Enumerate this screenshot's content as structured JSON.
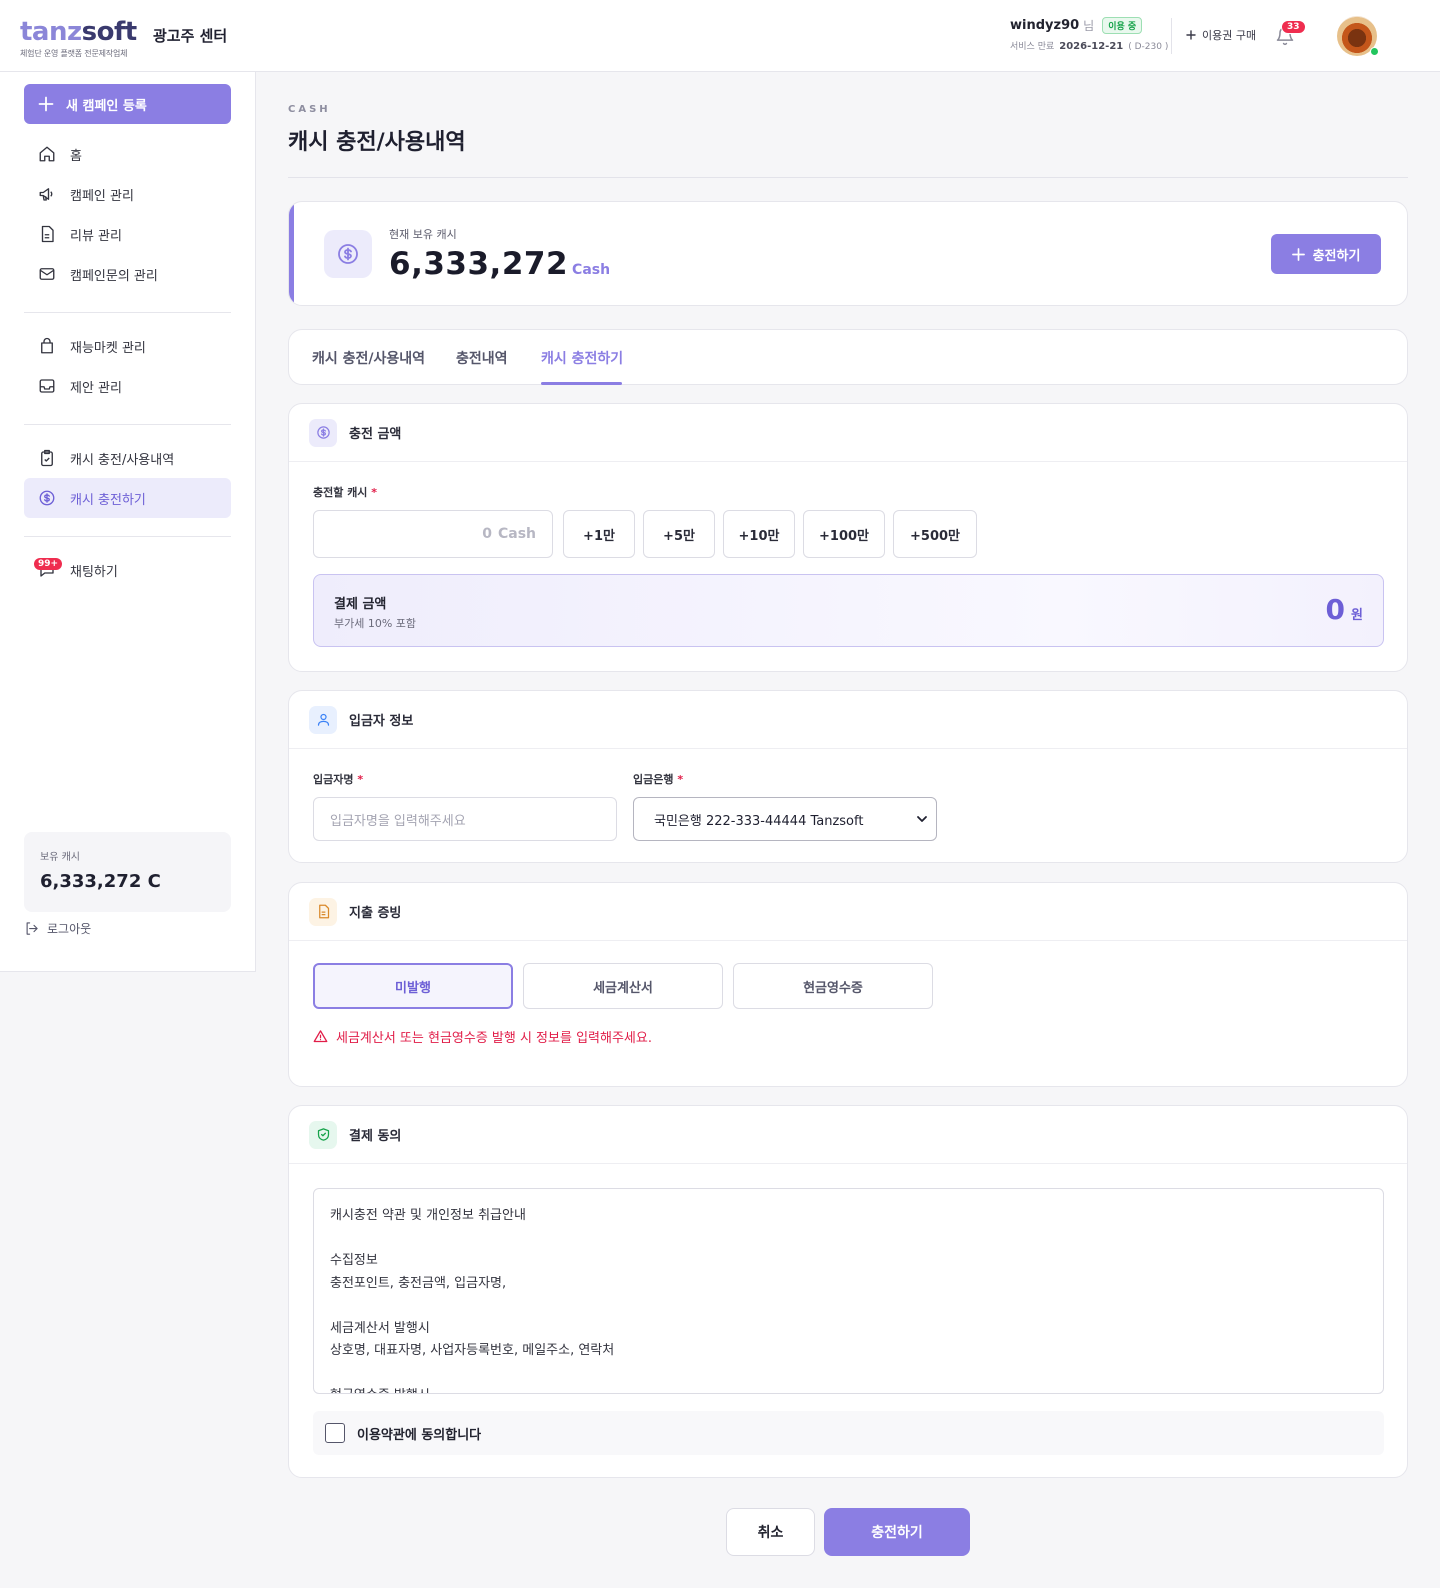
{
  "brand": {
    "logo_part1": "tanz",
    "logo_part2": "soft",
    "logo_tagline": "체험단 운영 플랫폼 전문제작업체",
    "center_title": "광고주 센터"
  },
  "user": {
    "name": "windyz90",
    "suffix": "님",
    "status": "이용 중",
    "service_label": "서비스 만료",
    "service_date": "2026-12-21",
    "dday": "( D-230 )"
  },
  "header": {
    "buy_label": "이용권 구매",
    "notification_count": "33"
  },
  "sidebar": {
    "new_campaign": "새 캠페인 등록",
    "items": [
      {
        "label": "홈",
        "icon": "home-icon"
      },
      {
        "label": "캠페인 관리",
        "icon": "megaphone-icon"
      },
      {
        "label": "리뷰 관리",
        "icon": "document-icon"
      },
      {
        "label": "캠페인문의 관리",
        "icon": "mail-icon"
      },
      {
        "label": "재능마켓 관리",
        "icon": "shopping-bag-icon"
      },
      {
        "label": "제안 관리",
        "icon": "inbox-icon"
      },
      {
        "label": "캐시 충전/사용내역",
        "icon": "clipboard-check-icon"
      },
      {
        "label": "캐시 충전하기",
        "icon": "dollar-circle-icon",
        "active": true
      },
      {
        "label": "채팅하기",
        "icon": "chat-icon"
      }
    ],
    "chat_badge": "99+",
    "cash_label": "보유 캐시",
    "cash_value": "6,333,272 C",
    "logout": "로그아웃"
  },
  "page": {
    "kicker": "CASH",
    "title": "캐시 충전/사용내역"
  },
  "balance": {
    "label": "현재 보유 캐시",
    "value": "6,333,272",
    "unit": "Cash",
    "charge_button": "충전하기"
  },
  "tabs": [
    {
      "label": "캐시 충전/사용내역"
    },
    {
      "label": "충전내역"
    },
    {
      "label": "캐시 충전하기",
      "active": true
    }
  ],
  "amount_section": {
    "title": "충전 금액",
    "field_label": "충전할 캐시",
    "required_mark": "*",
    "input_value": "0",
    "input_unit": "Cash",
    "quick_buttons": [
      "+1만",
      "+5만",
      "+10만",
      "+100만",
      "+500만"
    ],
    "pay_title": "결제 금액",
    "pay_sub": "부가세 10% 포함",
    "pay_amount": "0",
    "pay_unit": "원"
  },
  "depositor_section": {
    "title": "입금자 정보",
    "name_label": "입금자명",
    "name_placeholder": "입금자명을 입력해주세요",
    "bank_label": "입금은행",
    "bank_selected": "국민은행 222-333-44444 Tanzsoft",
    "required_mark": "*"
  },
  "proof_section": {
    "title": "지출 증빙",
    "options": [
      {
        "label": "미발행",
        "selected": true
      },
      {
        "label": "세금계산서"
      },
      {
        "label": "현금영수증"
      }
    ],
    "warning": "세금계산서 또는 현금영수증 발행 시 정보를 입력해주세요."
  },
  "agree_section": {
    "title": "결제 동의",
    "terms_lines": [
      "캐시충전 약관 및 개인정보 취급안내",
      "",
      "수집정보",
      "충전포인트, 충전금액, 입금자명,",
      "",
      "세금계산서 발행시",
      "상호명, 대표자명, 사업자등록번호, 메일주소, 연락처",
      "",
      "현금영수증 발행시"
    ],
    "agree_label": "이용약관에 동의합니다",
    "agreed": false
  },
  "actions": {
    "cancel": "취소",
    "submit": "충전하기"
  },
  "colors": {
    "accent": "#8b7ee3",
    "accent_dark": "#6d5fd6",
    "danger": "#e11d48",
    "success": "#16a34a"
  }
}
